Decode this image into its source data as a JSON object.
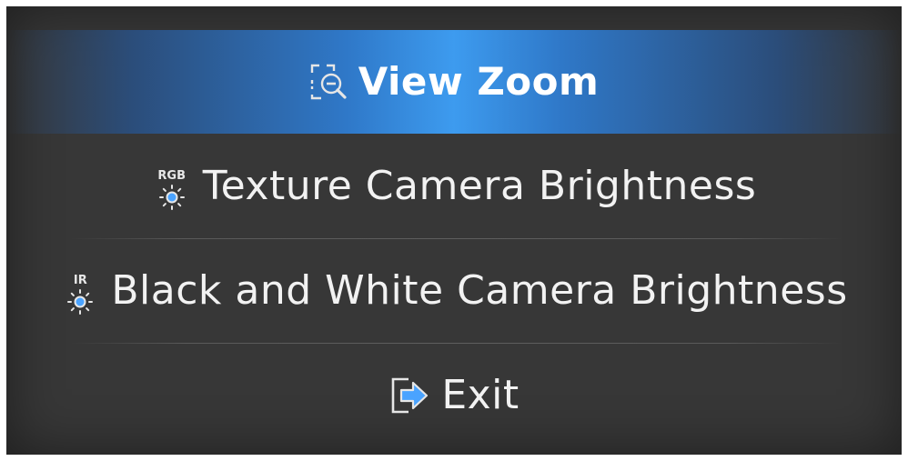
{
  "menu": {
    "items": [
      {
        "label": "View Zoom",
        "icon": "zoom-out-icon",
        "selected": true
      },
      {
        "label": "Texture Camera Brightness",
        "icon": "brightness-icon",
        "icon_tag": "RGB"
      },
      {
        "label": "Black and White Camera Brightness",
        "icon": "brightness-icon",
        "icon_tag": "IR"
      },
      {
        "label": "Exit",
        "icon": "exit-icon"
      }
    ]
  },
  "colors": {
    "panel_bg": "#373737",
    "selected_accent": "#3d9bef",
    "text": "#f2f2f2",
    "icon_blue": "#4aa3ff"
  }
}
